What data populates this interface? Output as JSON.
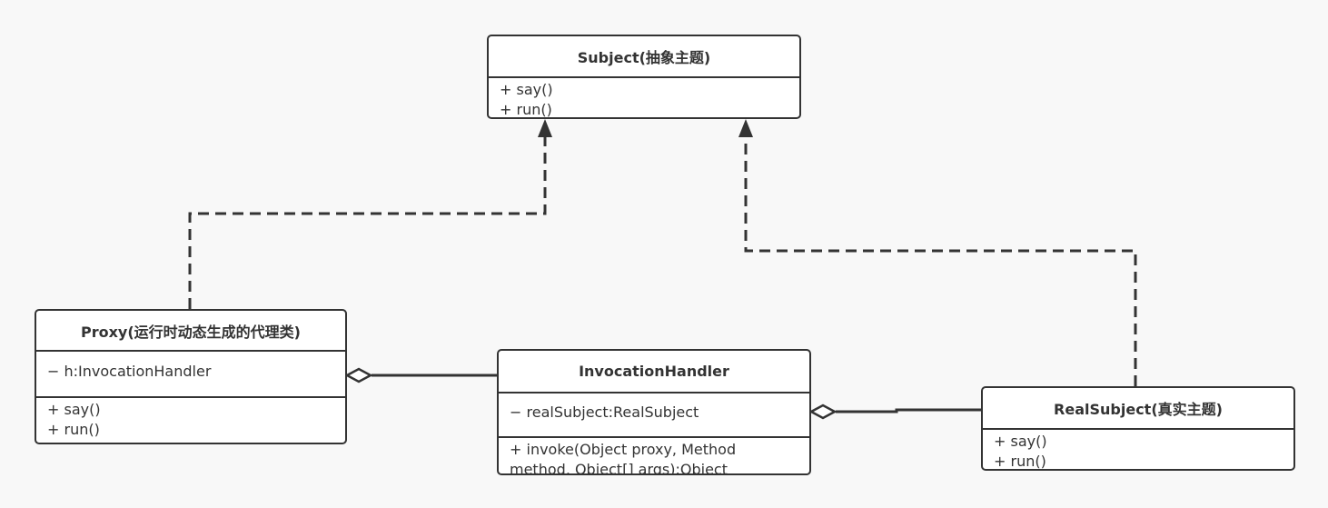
{
  "classes": {
    "subject": {
      "name": "Subject(抽象主题)",
      "methods": [
        "+ say()",
        "+ run()"
      ]
    },
    "proxy": {
      "name": "Proxy(运行时动态生成的代理类)",
      "attributes": [
        "− h:InvocationHandler"
      ],
      "methods": [
        "+ say()",
        "+ run()"
      ]
    },
    "handler": {
      "name": "InvocationHandler",
      "attributes": [
        "− realSubject:RealSubject"
      ],
      "methods": [
        "+ invoke(Object proxy, Method",
        "method, Object[] args):Object"
      ]
    },
    "real": {
      "name": "RealSubject(真实主题)",
      "methods": [
        "+ say()",
        "+ run()"
      ]
    }
  },
  "relations": [
    {
      "type": "realization",
      "from": "proxy",
      "to": "subject"
    },
    {
      "type": "realization",
      "from": "real",
      "to": "subject"
    },
    {
      "type": "aggregation",
      "whole": "proxy",
      "part": "handler"
    },
    {
      "type": "aggregation",
      "whole": "handler",
      "part": "real"
    }
  ]
}
